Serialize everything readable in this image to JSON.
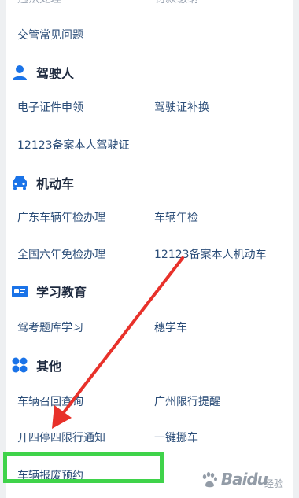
{
  "cutoff_row": {
    "left": "违法处理",
    "right": "罚款缴纳"
  },
  "faq": {
    "label": "交管常见问题"
  },
  "sections": {
    "driver": {
      "title": "驾驶人",
      "items": [
        "电子证件申领",
        "驾驶证补换",
        "12123备案本人驾驶证"
      ]
    },
    "vehicle": {
      "title": "机动车",
      "items": [
        "广东车辆年检办理",
        "车辆年检",
        "全国六年免检办理",
        "12123备案本人机动车"
      ]
    },
    "learning": {
      "title": "学习教育",
      "items": [
        "驾考题库学习",
        "穗学车"
      ]
    },
    "other": {
      "title": "其他",
      "items": [
        "车辆召回查询",
        "广州限行提醒",
        "开四停四限行通知",
        "一键挪车",
        "车辆报废预约"
      ]
    }
  },
  "watermark": {
    "brand": "Baidu",
    "sub": "经验"
  },
  "colors": {
    "accent": "#1a73e8",
    "highlight": "#3fd34a",
    "arrow": "#e8312a"
  }
}
